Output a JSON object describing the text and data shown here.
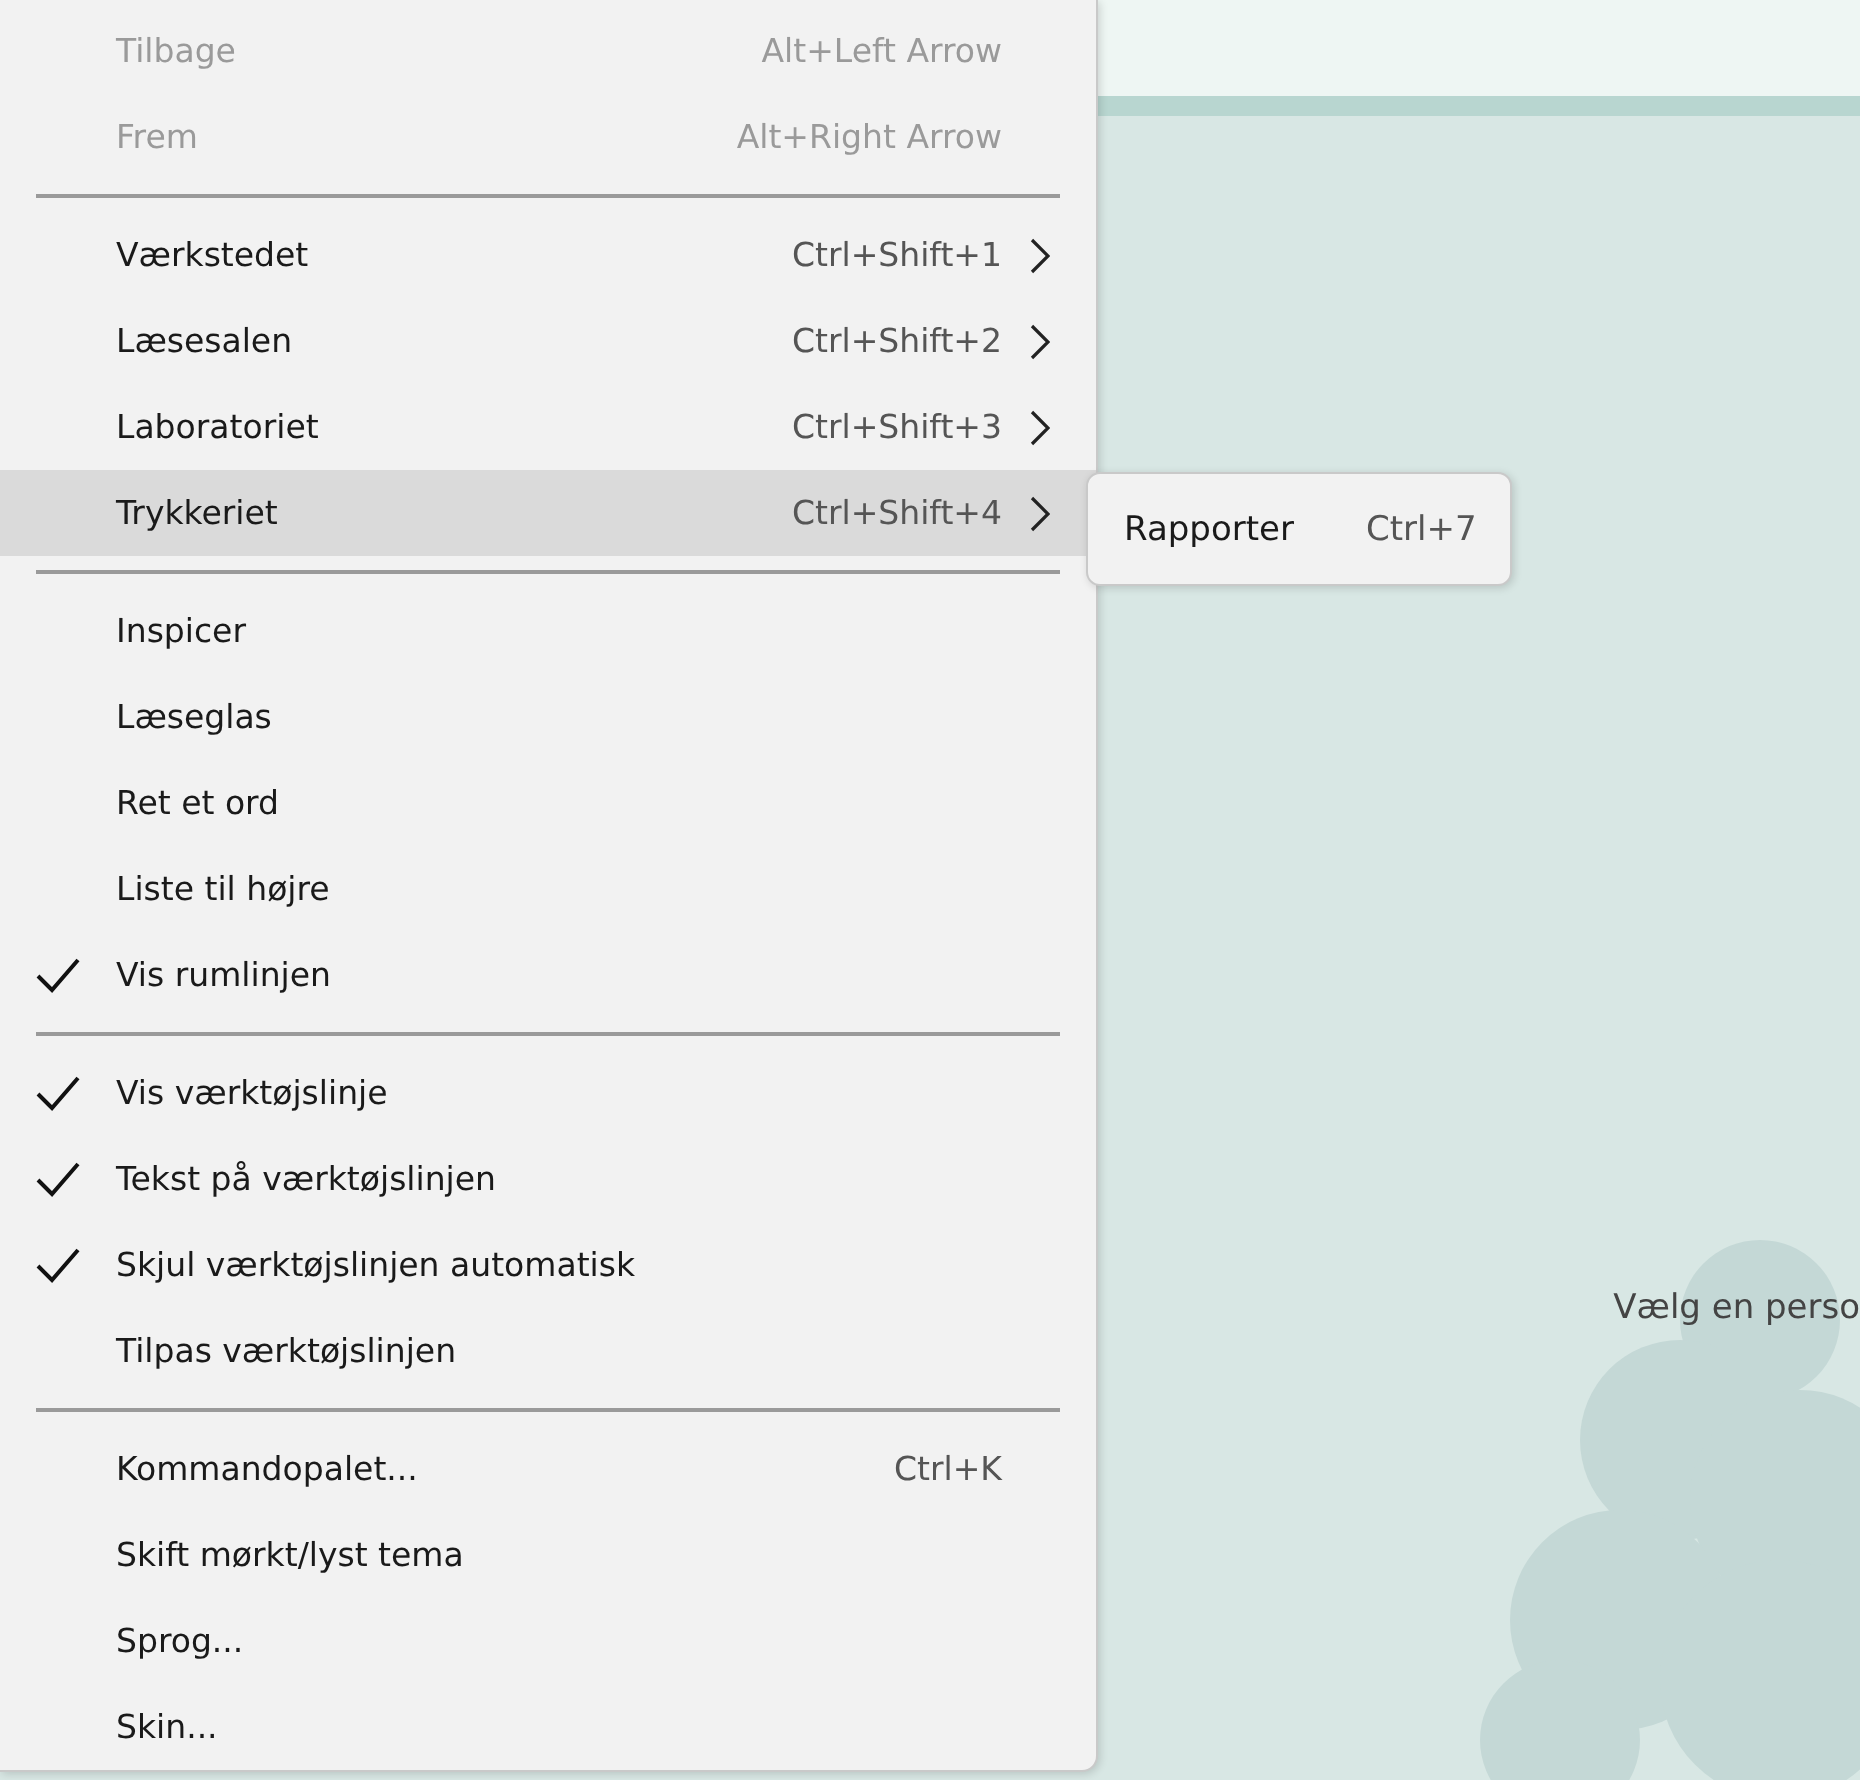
{
  "menu": {
    "items": [
      {
        "kind": "item",
        "label": "Tilbage",
        "shortcut": "Alt+Left Arrow",
        "disabled": true,
        "checked": false,
        "arrow": false,
        "selected": false
      },
      {
        "kind": "item",
        "label": "Frem",
        "shortcut": "Alt+Right Arrow",
        "disabled": true,
        "checked": false,
        "arrow": false,
        "selected": false
      },
      {
        "kind": "separator"
      },
      {
        "kind": "item",
        "label": "Værkstedet",
        "shortcut": "Ctrl+Shift+1",
        "disabled": false,
        "checked": false,
        "arrow": true,
        "selected": false
      },
      {
        "kind": "item",
        "label": "Læsesalen",
        "shortcut": "Ctrl+Shift+2",
        "disabled": false,
        "checked": false,
        "arrow": true,
        "selected": false
      },
      {
        "kind": "item",
        "label": "Laboratoriet",
        "shortcut": "Ctrl+Shift+3",
        "disabled": false,
        "checked": false,
        "arrow": true,
        "selected": false
      },
      {
        "kind": "item",
        "label": "Trykkeriet",
        "shortcut": "Ctrl+Shift+4",
        "disabled": false,
        "checked": false,
        "arrow": true,
        "selected": true,
        "submenu": [
          {
            "label": "Rapporter",
            "shortcut": "Ctrl+7"
          }
        ]
      },
      {
        "kind": "separator"
      },
      {
        "kind": "item",
        "label": "Inspicer",
        "disabled": false,
        "checked": false,
        "arrow": false,
        "selected": false
      },
      {
        "kind": "item",
        "label": "Læseglas",
        "disabled": false,
        "checked": false,
        "arrow": false,
        "selected": false
      },
      {
        "kind": "item",
        "label": "Ret et ord",
        "disabled": false,
        "checked": false,
        "arrow": false,
        "selected": false
      },
      {
        "kind": "item",
        "label": "Liste til højre",
        "disabled": false,
        "checked": false,
        "arrow": false,
        "selected": false
      },
      {
        "kind": "item",
        "label": "Vis rumlinjen",
        "disabled": false,
        "checked": true,
        "arrow": false,
        "selected": false
      },
      {
        "kind": "separator"
      },
      {
        "kind": "item",
        "label": "Vis værktøjslinje",
        "disabled": false,
        "checked": true,
        "arrow": false,
        "selected": false
      },
      {
        "kind": "item",
        "label": "Tekst på værktøjslinjen",
        "disabled": false,
        "checked": true,
        "arrow": false,
        "selected": false
      },
      {
        "kind": "item",
        "label": "Skjul værktøjslinjen automatisk",
        "disabled": false,
        "checked": true,
        "arrow": false,
        "selected": false
      },
      {
        "kind": "item",
        "label": "Tilpas værktøjslinjen",
        "disabled": false,
        "checked": false,
        "arrow": false,
        "selected": false
      },
      {
        "kind": "separator"
      },
      {
        "kind": "item",
        "label": "Kommandopalet...",
        "shortcut": "Ctrl+K",
        "disabled": false,
        "checked": false,
        "arrow": false,
        "selected": false
      },
      {
        "kind": "item",
        "label": "Skift mørkt/lyst tema",
        "disabled": false,
        "checked": false,
        "arrow": false,
        "selected": false
      },
      {
        "kind": "item",
        "label": "Sprog...",
        "disabled": false,
        "checked": false,
        "arrow": false,
        "selected": false
      },
      {
        "kind": "item",
        "label": "Skin...",
        "disabled": false,
        "checked": false,
        "arrow": false,
        "selected": false
      }
    ]
  },
  "main": {
    "hint": "Vælg en perso"
  }
}
